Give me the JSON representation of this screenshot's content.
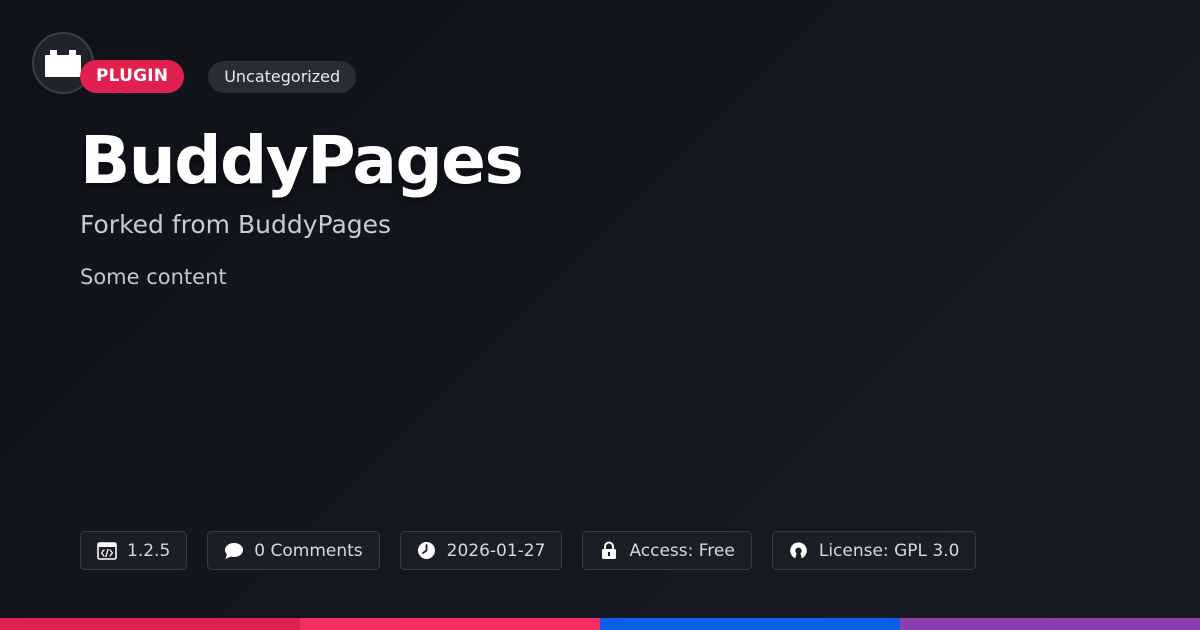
{
  "tags": {
    "type": "PLUGIN",
    "category": "Uncategorized"
  },
  "title": "BuddyPages",
  "subtitle": "Forked from BuddyPages",
  "content": "Some content",
  "meta": {
    "version": "1.2.5",
    "comments": "0 Comments",
    "date": "2026-01-27",
    "access": "Access: Free",
    "license": "License: GPL 3.0"
  },
  "icons": {
    "logo": "plugin-block-icon",
    "version": "code-window-icon",
    "comments": "speech-bubble-icon",
    "date": "clock-icon",
    "access": "lock-icon",
    "license": "open-source-icon"
  },
  "colors": {
    "background": "#12141b",
    "plugin_tag": "#e0214f",
    "category_tag": "#2a2d35",
    "bar_1": "#e0214f",
    "bar_2": "#f42e63",
    "bar_3": "#0a5fe6",
    "bar_4": "#8a3fb0"
  }
}
